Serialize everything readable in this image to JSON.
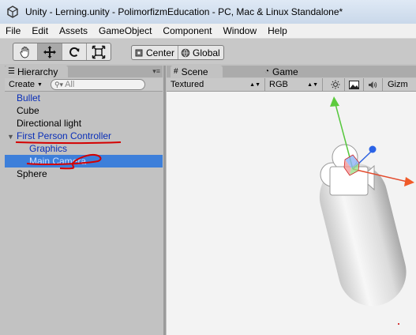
{
  "window": {
    "title": "Unity - Lerning.unity - PolimorfizmEducation - PC, Mac & Linux Standalone*"
  },
  "menu": [
    "File",
    "Edit",
    "Assets",
    "GameObject",
    "Component",
    "Window",
    "Help"
  ],
  "toolbar": {
    "tools": [
      "hand-tool-icon",
      "move-tool-icon",
      "rotate-tool-icon",
      "scale-tool-icon"
    ],
    "active_tool": "move-tool-icon",
    "pivot_label": "Center",
    "space_label": "Global"
  },
  "hierarchy": {
    "tab_label": "Hierarchy",
    "create_label": "Create",
    "search_placeholder": "All",
    "items": [
      {
        "label": "Bullet",
        "indent": 0,
        "color": "blue"
      },
      {
        "label": "Cube",
        "indent": 0,
        "color": "black"
      },
      {
        "label": "Directional light",
        "indent": 0,
        "color": "black"
      },
      {
        "label": "First Person Controller",
        "indent": 0,
        "color": "blue",
        "expanded": true
      },
      {
        "label": "Graphics",
        "indent": 1,
        "color": "blue"
      },
      {
        "label": "Main Camera",
        "indent": 1,
        "color": "blue",
        "selected": true
      },
      {
        "label": "Sphere",
        "indent": 0,
        "color": "black"
      }
    ]
  },
  "scene": {
    "scene_tab_label": "Scene",
    "game_tab_label": "Game",
    "render_mode": "Textured",
    "color_mode": "RGB",
    "gizmos_label": "Gizm"
  },
  "colors": {
    "selection": "#3d7fda",
    "annotation_red": "#d40000",
    "object_blue": "#0a2fb8"
  }
}
